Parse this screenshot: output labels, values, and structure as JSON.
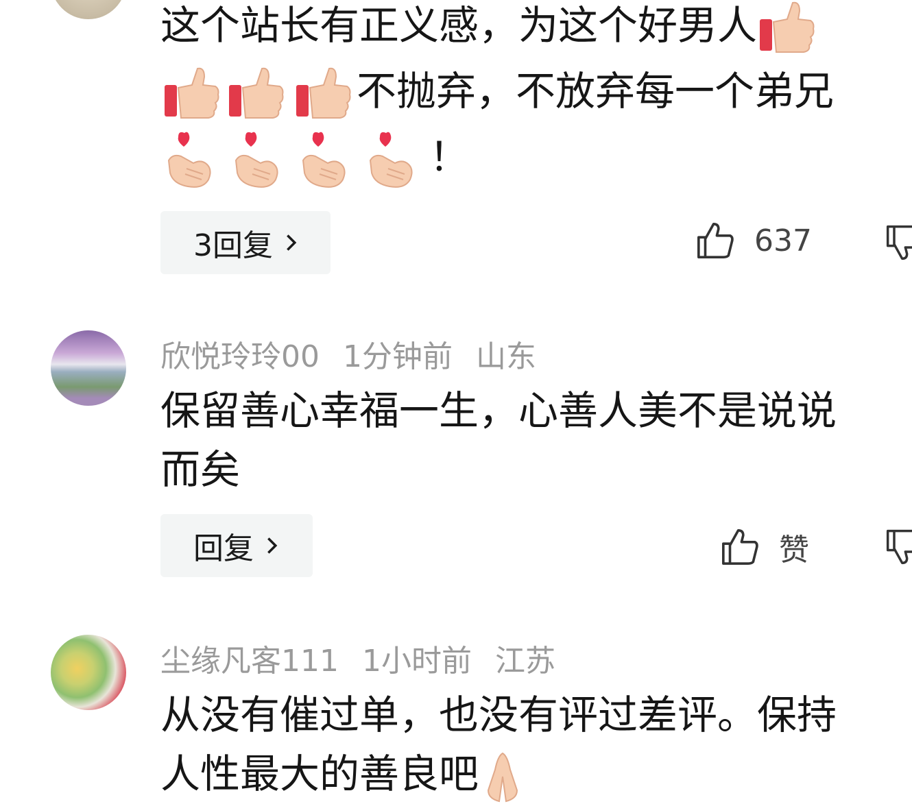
{
  "comments": [
    {
      "text_line1": "这个站长有正义感，为这个好男人",
      "text_line2": "不抛弃，不放弃每一个弟兄",
      "text_line3_suffix": "！",
      "reply_label": "3回复",
      "like_count": "637"
    },
    {
      "username": "欣悦玲玲00",
      "time": "1分钟前",
      "location": "山东",
      "text_line1": "保留善心幸福一生，心善人美不是说说",
      "text_line2": "而矣",
      "reply_label": "回复",
      "like_count": "赞"
    },
    {
      "username": "尘缘凡客111",
      "time": "1小时前",
      "location": "江苏",
      "text_line1": "从没有催过单，也没有评过差评。保持",
      "text_line2": "人性最大的善良吧"
    }
  ],
  "icons": [
    "thumbs-up-emoji",
    "finger-heart-emoji",
    "like-icon",
    "dislike-icon",
    "chevron-right-icon",
    "pray-emoji"
  ],
  "colors": {
    "meta_text": "#9a9a9a",
    "reply_bg": "#f3f5f5",
    "body_text": "#161616"
  }
}
